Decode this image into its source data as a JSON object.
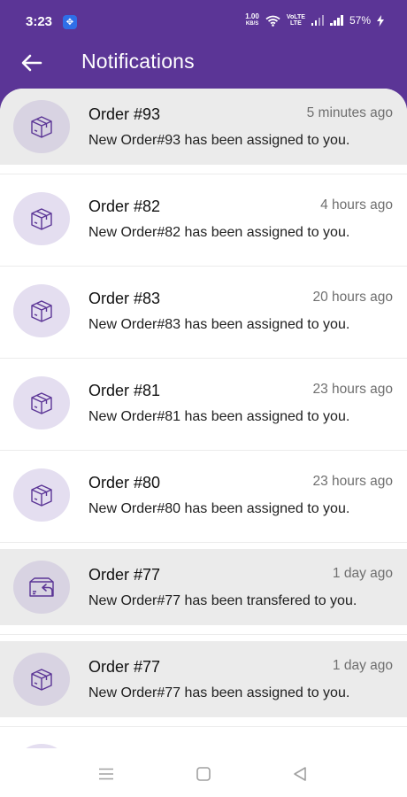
{
  "status_bar": {
    "time": "3:23",
    "app_badge": "✥",
    "speed_value": "1.00",
    "speed_unit": "KB/S",
    "volte_top": "VoLTE",
    "volte_bottom": "LTE",
    "battery": "57%"
  },
  "header": {
    "title": "Notifications",
    "back_icon": "arrow-left-icon",
    "background": "#5b3596"
  },
  "notifications": [
    {
      "title": "Order #93",
      "time": "5 minutes ago",
      "message": "New Order#93 has been assigned to you.",
      "icon": "package-icon",
      "unread": true
    },
    {
      "title": "Order #82",
      "time": "4 hours ago",
      "message": "New Order#82 has been assigned to you.",
      "icon": "package-icon",
      "unread": false
    },
    {
      "title": "Order #83",
      "time": "20 hours ago",
      "message": "New Order#83 has been assigned to you.",
      "icon": "package-icon",
      "unread": false
    },
    {
      "title": "Order #81",
      "time": "23 hours ago",
      "message": "New Order#81 has been assigned to you.",
      "icon": "package-icon",
      "unread": false
    },
    {
      "title": "Order #80",
      "time": "23 hours ago",
      "message": "New Order#80 has been assigned to you.",
      "icon": "package-icon",
      "unread": false
    },
    {
      "title": "Order #77",
      "time": "1 day ago",
      "message": "New Order#77 has been transfered to you.",
      "icon": "package-transfer-icon",
      "unread": true
    },
    {
      "title": "Order #77",
      "time": "1 day ago",
      "message": "New Order#77 has been assigned to you.",
      "icon": "package-icon",
      "unread": true
    }
  ],
  "nav_bar": {
    "menu_icon": "menu-icon",
    "home_icon": "home-square-icon",
    "back_icon": "back-triangle-icon"
  }
}
